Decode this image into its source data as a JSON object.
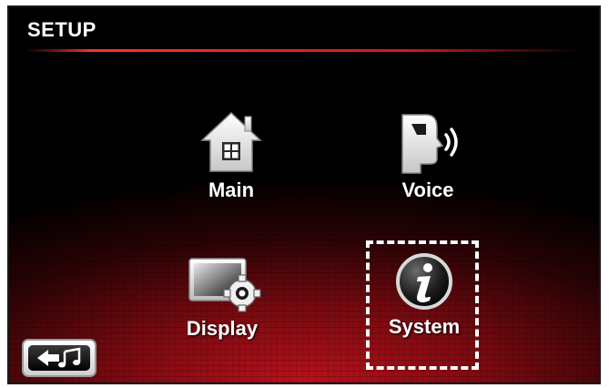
{
  "header": {
    "title": "SETUP"
  },
  "menu": {
    "main": {
      "label": "Main",
      "icon": "home-icon"
    },
    "voice": {
      "label": "Voice",
      "icon": "voice-icon"
    },
    "display": {
      "label": "Display",
      "icon": "display-settings-icon"
    },
    "system": {
      "label": "System",
      "icon": "info-icon"
    }
  },
  "back_button": {
    "icon": "back-music-icon"
  },
  "colors": {
    "background_top": "#000000",
    "background_glow": "#b8121c",
    "accent_line": "#ff3030",
    "text": "#ffffff",
    "focus_outline": "#ffffff"
  }
}
